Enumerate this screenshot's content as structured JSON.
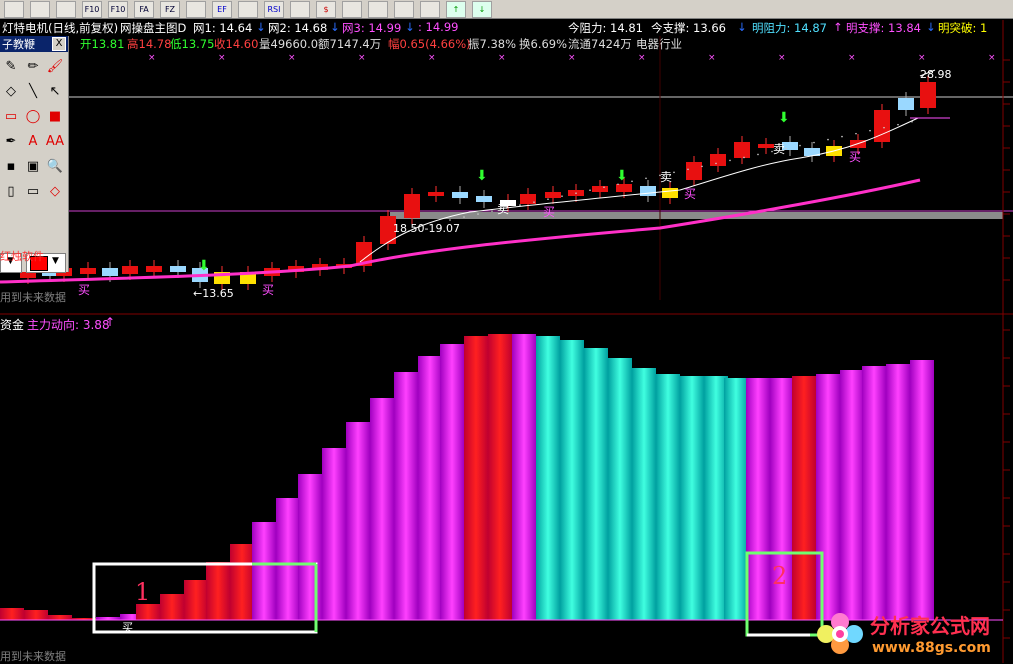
{
  "toolbar": {
    "icons": [
      "table-icon",
      "line-chart-icon",
      "grid-icon",
      "f10-icon",
      "f10b-icon",
      "fa-icon",
      "fz-icon",
      "search-icon",
      "ef-icon",
      "chart-icon",
      "rsi-icon",
      "list-icon",
      "dollar-icon",
      "paper-icon",
      "arrow-icon",
      "pencil-icon",
      "move-icon",
      "up-arrow-icon",
      "down-arrow-icon"
    ],
    "labels": [
      "",
      "",
      "",
      "F10",
      "F10",
      "FA",
      "FZ",
      "",
      "EF",
      "",
      "RSI",
      "",
      "$",
      "",
      "",
      "",
      "",
      "↑",
      "↓"
    ]
  },
  "header": {
    "title": "灯特电机(日线,前复权)",
    "indicator_name": "网操盘主图D",
    "w1_label": "网1: 14.64",
    "w2_label": "网2: 14.68",
    "w3_label": "网3: 14.99",
    "w4_label": ": 14.99",
    "resist_label": "今阻力: 14.81",
    "support_label": "今支撑: 13.66",
    "next_resist_label": "明阻力: 14.87",
    "next_support_label": "明支撑: 13.84",
    "breakout_label": "明突破: 1"
  },
  "quote": {
    "open": "开13.81",
    "high": "高14.78",
    "low": "低13.75",
    "close": "收14.60",
    "volume": "量49660.0",
    "amount": "额7147.4万",
    "change": "幅0.65(4.66%)",
    "amplitude": "振7.38%",
    "turnover": "换6.69%",
    "float": "流通7424万",
    "industry": "电器行业"
  },
  "palette": {
    "title": "子教鞭",
    "close": "X",
    "software": "红烛软件",
    "cells": [
      "eraser-icon",
      "pencil-icon",
      "paint-icon",
      "minus-icon",
      "line-icon",
      "arrow-icon",
      "rect-icon",
      "ellipse-icon",
      "fill-rect-icon",
      "pen-icon",
      "text-icon",
      "aa-icon",
      "frame-icon",
      "image-icon",
      "zoom-icon",
      "doc-icon",
      "folder-icon",
      "diamond-icon"
    ],
    "glyphs": [
      "✎",
      "✏",
      "🖌",
      "◇",
      "╲",
      "↖",
      "▭",
      "◯",
      "■",
      "✒",
      "A",
      "AA",
      "▪",
      "▣",
      "🔍",
      "▯",
      "▭",
      "◇"
    ]
  },
  "chart_top": {
    "price_labels": [
      "28.98",
      "18.50-19.07",
      "←13.65"
    ],
    "signals": [
      "买",
      "卖",
      "买",
      "买",
      "卖",
      "买",
      "卖",
      "买"
    ],
    "footer": "用到未来数据"
  },
  "chart_bottom": {
    "title": "资金",
    "line_label": "主力动向: 3.88",
    "box_labels": [
      "1",
      "2"
    ],
    "buy_label": "买",
    "footer": "用到未来数据"
  },
  "colors": {
    "up": "#ff2020",
    "down": "#50d0ff",
    "magenta": "#ff00ff",
    "cyan": "#00ffd0",
    "ma": "#ff30c8"
  },
  "logo": {
    "cn": "分析家公式网",
    "url": "www.88gs.com"
  }
}
